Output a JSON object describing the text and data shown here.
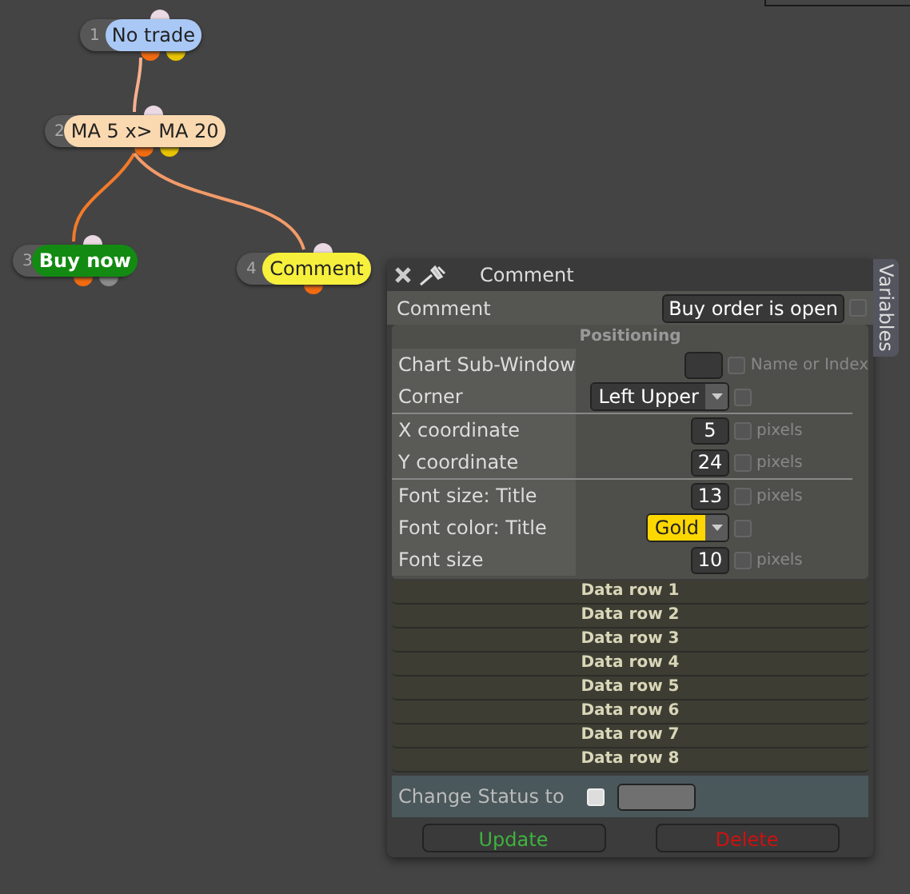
{
  "nodes": [
    {
      "number": "1",
      "label": "No trade",
      "color": "#a9c8f5",
      "outputs": [
        {
          "color": "#f26b10"
        },
        {
          "color": "#e8c400"
        }
      ]
    },
    {
      "number": "2",
      "label": "MA 5 x> MA 20",
      "color": "#fbd9b0",
      "outputs": [
        {
          "color": "#f26b10"
        },
        {
          "color": "#e8c400"
        }
      ]
    },
    {
      "number": "3",
      "label": "Buy now",
      "color": "#138a12",
      "outputs": [
        {
          "color": "#f26b10"
        },
        {
          "color": "#8a8a8a"
        }
      ]
    },
    {
      "number": "4",
      "label": "Comment",
      "color": "#f6f03c",
      "outputs": [
        {
          "color": "#f26b10"
        }
      ]
    }
  ],
  "panel": {
    "title": "Comment",
    "side_tab": "Variables",
    "comment": {
      "label": "Comment",
      "value": "Buy order is open",
      "checked": false
    },
    "section_title": "Positioning",
    "groups": [
      [
        {
          "label": "Chart Sub-Window",
          "kind": "field",
          "checked": false,
          "unit": "Name or Index"
        },
        {
          "label": "Corner",
          "kind": "select",
          "value": "Left Upper",
          "checked": false
        }
      ],
      [
        {
          "label": "X coordinate",
          "kind": "field",
          "value": "5",
          "checked": false,
          "unit": "pixels"
        },
        {
          "label": "Y coordinate",
          "kind": "field",
          "value": "24",
          "checked": false,
          "unit": "pixels"
        }
      ],
      [
        {
          "label": "Font size: Title",
          "kind": "field",
          "value": "13",
          "checked": false,
          "unit": "pixels"
        },
        {
          "label": "Font color: Title",
          "kind": "color_select",
          "value": "Gold",
          "color": "#ffd700",
          "checked": false
        },
        {
          "label": "Font size",
          "kind": "field",
          "value": "10",
          "checked": false,
          "unit": "pixels"
        }
      ]
    ],
    "data_rows": [
      "Data row 1",
      "Data row 2",
      "Data row 3",
      "Data row 4",
      "Data row 5",
      "Data row 6",
      "Data row 7",
      "Data row 8"
    ],
    "status": {
      "label": "Change Status to",
      "checked": false
    },
    "buttons": [
      {
        "label": "Update",
        "kind": "update"
      },
      {
        "label": "Delete",
        "kind": "delete"
      }
    ]
  }
}
